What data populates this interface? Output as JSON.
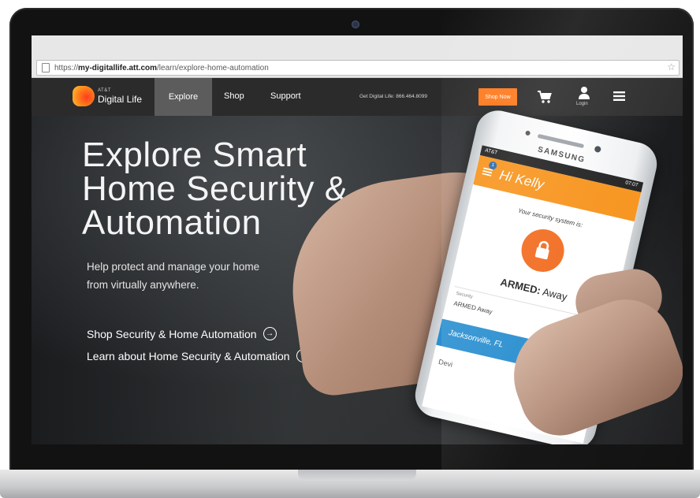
{
  "browser": {
    "url_prefix": "https://",
    "url_domain": "my-digitallife.att.com",
    "url_path": "/learn/explore-home-automation"
  },
  "site_nav": {
    "logo_att": "AT&T",
    "logo_text": "Digital Life",
    "items": [
      {
        "label": "Explore",
        "active": true
      },
      {
        "label": "Shop",
        "active": false
      },
      {
        "label": "Support",
        "active": false
      }
    ],
    "phone_text": "Get Digital Life: 866.464.8099",
    "shop_now": "Shop Now",
    "login_label": "Login",
    "icons": [
      "cart-icon",
      "user-icon",
      "hamburger-menu-icon"
    ],
    "accent_color": "#ff7a1e"
  },
  "hero": {
    "title_line1": "Explore Smart",
    "title_line2": "Home Security &",
    "title_line3": "Automation",
    "subtitle_line1": "Help protect and manage your home",
    "subtitle_line2": "from virtually anywhere.",
    "cta_shop": "Shop Security & Home Automation",
    "cta_learn": "Learn about Home Security & Automation",
    "cta_shop_icon": "arrow-right-circle-icon",
    "cta_learn_icon": "arrow-down-circle-icon"
  },
  "phone": {
    "brand": "SAMSUNG",
    "carrier": "AT&T",
    "time": "07:07",
    "notification_count": "1",
    "greeting": "Hi Kelly",
    "security_label": "Your security system is:",
    "armed_bold": "ARMED:",
    "armed_state": "Away",
    "security_small": "Security",
    "security_state": "ARMED Away",
    "location": "Jacksonville, FL",
    "device_text": "Devi",
    "header_color": "#f7941d",
    "lock_color": "#f26d21",
    "location_color": "#2a8fd0"
  }
}
